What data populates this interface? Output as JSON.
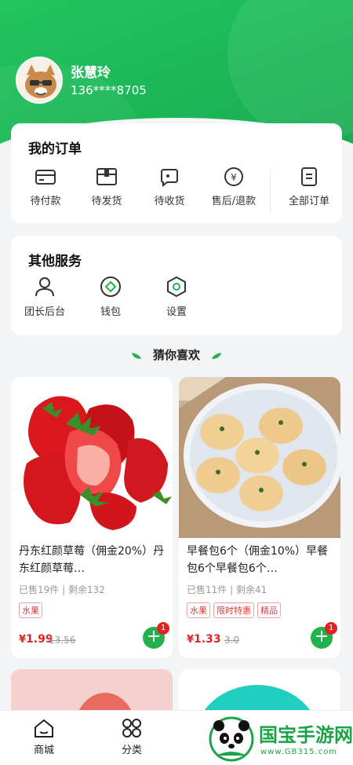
{
  "colors": {
    "brand": "#1bb556",
    "price": "#e02424",
    "tag": "#e23b3b"
  },
  "user": {
    "name": "张慧玲",
    "phone": "136****8705"
  },
  "orders": {
    "title": "我的订单",
    "items": [
      {
        "label": "待付款",
        "icon": "card-icon"
      },
      {
        "label": "待发货",
        "icon": "box-icon"
      },
      {
        "label": "待收货",
        "icon": "truck-icon"
      },
      {
        "label": "售后/退款",
        "icon": "refund-icon"
      },
      {
        "label": "全部订单",
        "icon": "list-icon"
      }
    ]
  },
  "services": {
    "title": "其他服务",
    "items": [
      {
        "label": "团长后台",
        "icon": "person-icon"
      },
      {
        "label": "钱包",
        "icon": "wallet-icon"
      },
      {
        "label": "设置",
        "icon": "settings-icon"
      }
    ]
  },
  "guess": {
    "title": "猜你喜欢"
  },
  "products": [
    {
      "name": "丹东红颜草莓（佣金20%）丹东红颜草莓…",
      "sold": "已售19件 | 剩余132",
      "tags": [
        "水果"
      ],
      "currency": "¥",
      "price": "1.99",
      "original": "13.56",
      "cart_count": "1"
    },
    {
      "name": "早餐包6个（佣金10%）早餐包6个早餐包6个…",
      "sold": "已售11件 | 剩余41",
      "tags": [
        "水果",
        "限时特惠",
        "精品"
      ],
      "currency": "¥",
      "price": "1.33",
      "original": "3.0",
      "cart_count": "1"
    }
  ],
  "tabbar": {
    "items": [
      {
        "label": "商城",
        "icon": "home-icon"
      },
      {
        "label": "分类",
        "icon": "grid-icon"
      }
    ]
  },
  "watermark": {
    "title": "国宝手游网",
    "url": "www.GB315.com"
  }
}
